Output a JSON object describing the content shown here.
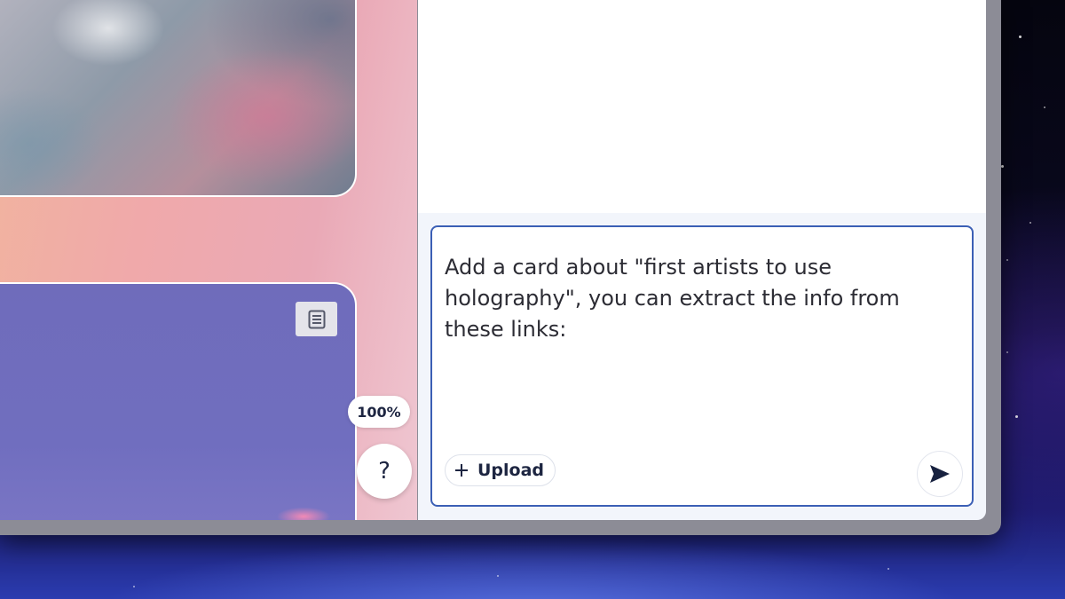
{
  "canvas": {
    "zoom_level": "100%",
    "help_label": "?"
  },
  "composer": {
    "text": "Add a card about \"first artists to use holography\", you can extract the info from these links:",
    "upload_label": "Upload"
  },
  "icons": {
    "note": "note-icon",
    "plus": "plus-icon",
    "send": "send-icon"
  },
  "colors": {
    "accent_border": "#3b5fb5",
    "text_dark": "#1d2541"
  }
}
